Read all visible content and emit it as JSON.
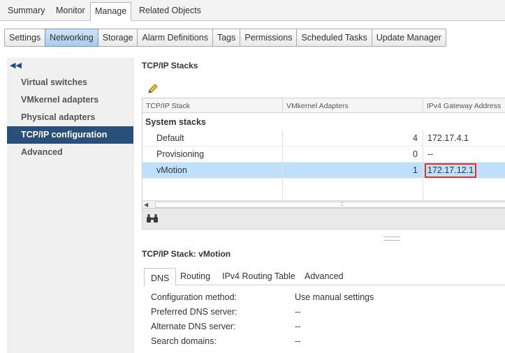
{
  "top_tabs": [
    "Summary",
    "Monitor",
    "Manage",
    "Related Objects"
  ],
  "subtabs": [
    "Settings",
    "Networking",
    "Storage",
    "Alarm Definitions",
    "Tags",
    "Permissions",
    "Scheduled Tasks",
    "Update Manager"
  ],
  "nav": {
    "collapse_icon": "double-chevron-left-icon",
    "items": [
      "Virtual switches",
      "VMkernel adapters",
      "Physical adapters",
      "TCP/IP configuration",
      "Advanced"
    ]
  },
  "stacks_panel": {
    "title": "TCP/IP Stacks",
    "edit_icon": "pencil-icon",
    "columns": [
      "TCP/IP Stack",
      "VMkernel Adapters",
      "IPv4 Gateway Address"
    ],
    "group_label": "System stacks",
    "rows": [
      {
        "name": "Default",
        "adapters": "4",
        "gateway": "172.17.4.1"
      },
      {
        "name": "Provisioning",
        "adapters": "0",
        "gateway": "--"
      },
      {
        "name": "vMotion",
        "adapters": "1",
        "gateway": "172.17.12.1"
      }
    ],
    "find_icon": "binoculars-icon"
  },
  "detail_panel": {
    "title": "TCP/IP Stack: vMotion",
    "tabs": [
      "DNS",
      "Routing",
      "IPv4 Routing Table",
      "Advanced"
    ],
    "properties": [
      {
        "label": "Configuration method:",
        "value": "Use manual settings"
      },
      {
        "label": "Preferred DNS server:",
        "value": "--"
      },
      {
        "label": "Alternate DNS server:",
        "value": "--"
      },
      {
        "label": "Search domains:",
        "value": "--"
      }
    ]
  },
  "colors": {
    "nav_active": "#2a4f7a",
    "row_selected": "#bfe0fb",
    "highlight_box": "#e0302f",
    "subtab_active": "#a9ccef"
  }
}
